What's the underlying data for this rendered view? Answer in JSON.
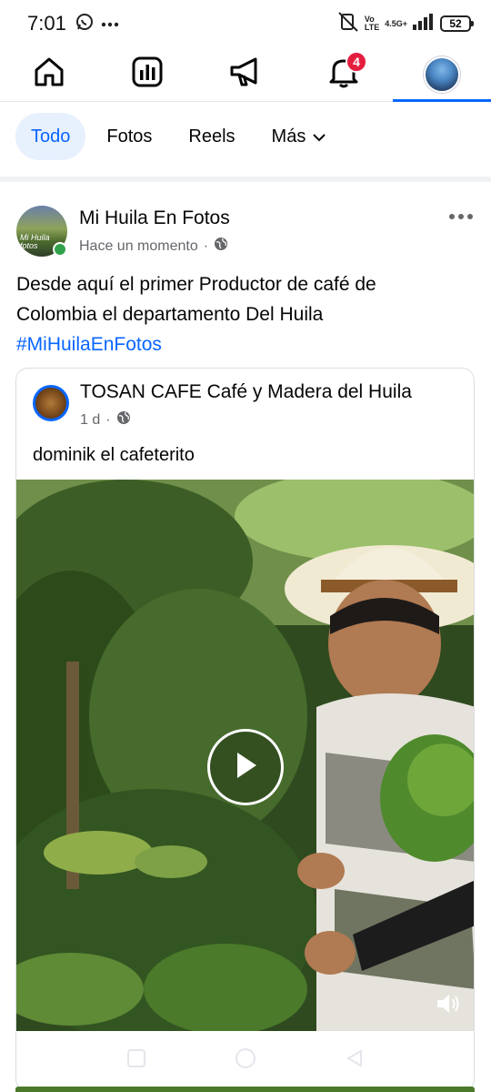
{
  "status_bar": {
    "time": "7:01",
    "network_vo": "Vo",
    "network_lte": "LTE",
    "network_gen": "4.5G+",
    "battery": "52"
  },
  "top_nav": {
    "items": [
      "home",
      "dashboard",
      "announcements",
      "notifications",
      "profile"
    ],
    "notification_count": "4",
    "active_item": "profile"
  },
  "filters": {
    "items": [
      "Todo",
      "Fotos",
      "Reels",
      "Más"
    ],
    "active": "Todo"
  },
  "post": {
    "author": "Mi Huila En Fotos",
    "avatar_text": "Mi Huila fotos",
    "time": "Hace un momento",
    "separator": "·",
    "text_line1": "Desde aquí el primer Productor de café de",
    "text_line2": "Colombia el departamento Del Huila",
    "hashtag": "#MiHuilaEnFotos"
  },
  "shared": {
    "author": "TOSAN CAFE Café y Madera del Huila",
    "time": "1 d",
    "separator": "·",
    "text": "dominik el cafeterito"
  },
  "colors": {
    "accent": "#0866ff",
    "badge": "#e41e3f",
    "online": "#31a24c",
    "meta": "#65676b"
  }
}
